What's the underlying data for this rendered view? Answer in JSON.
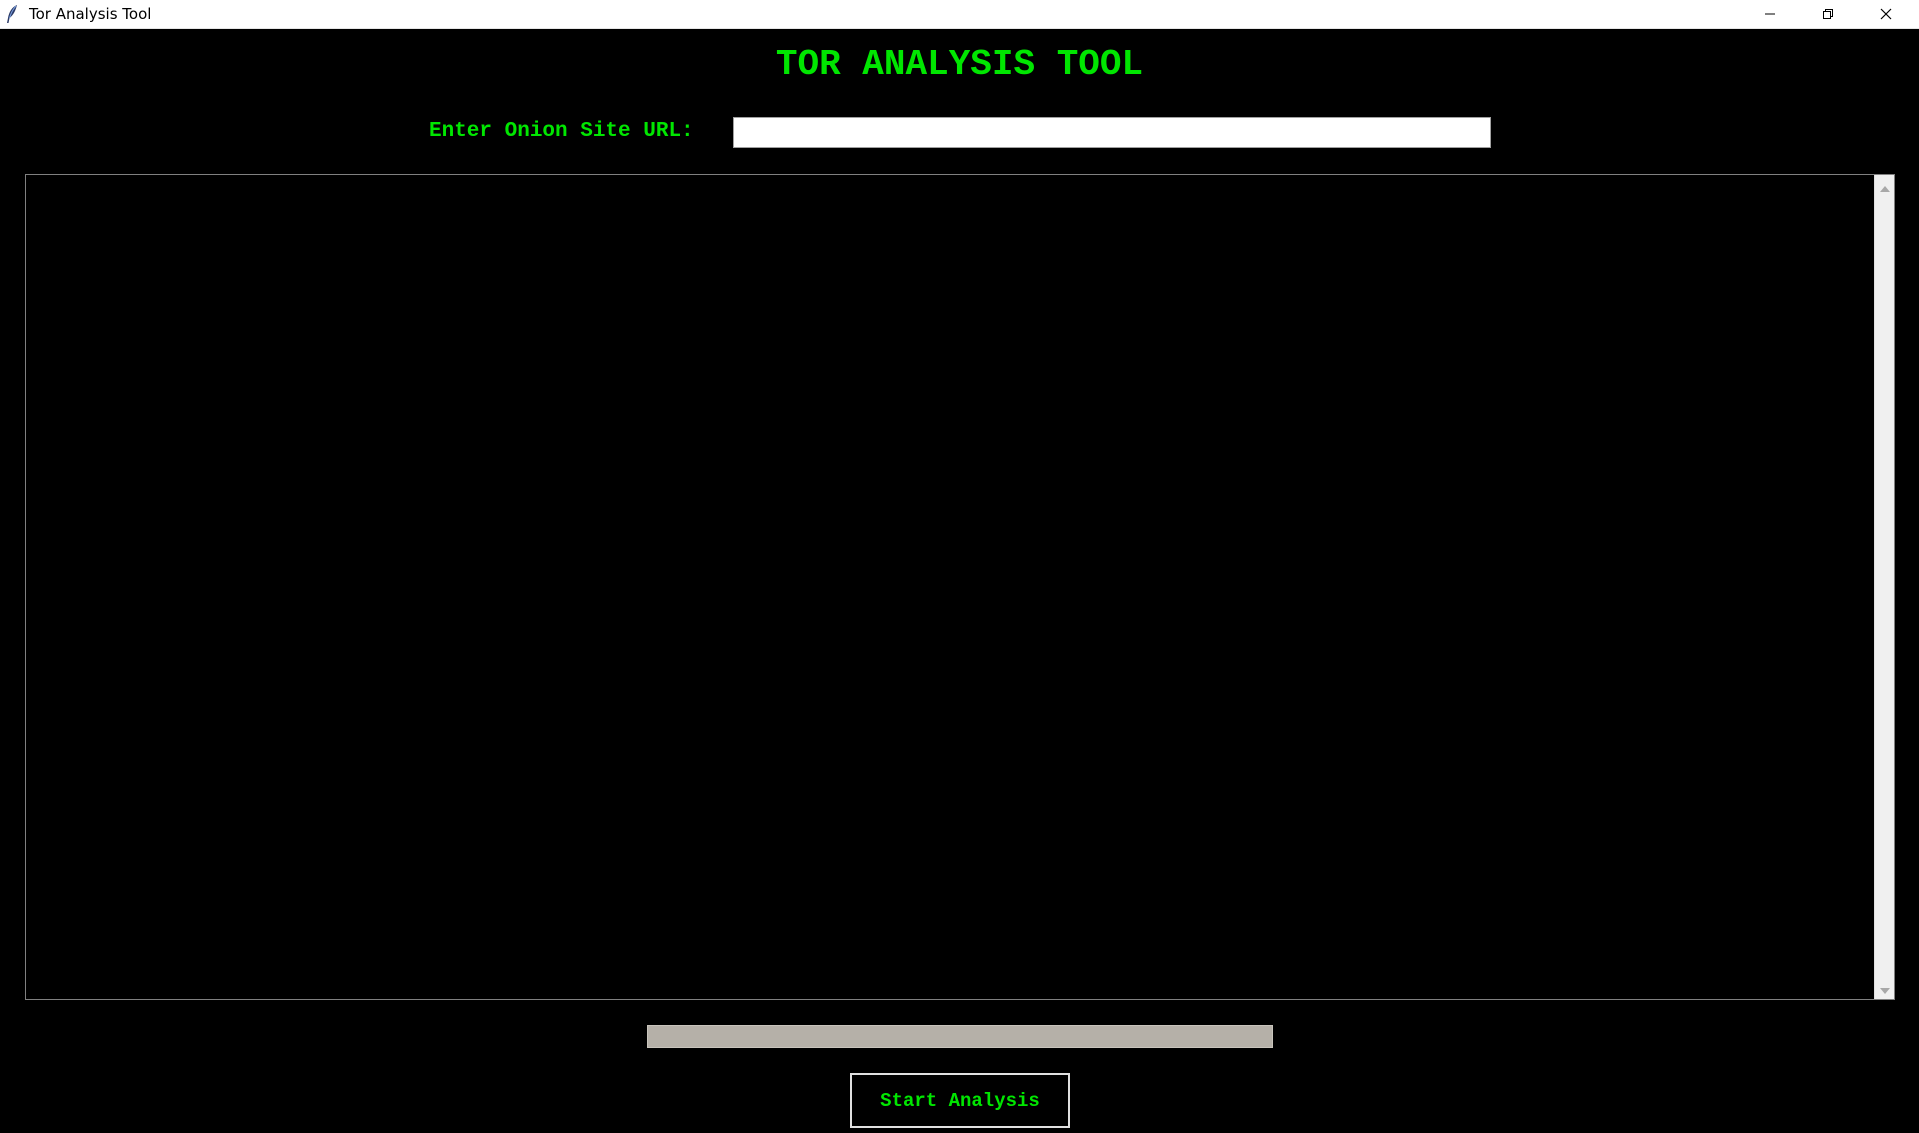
{
  "window": {
    "title": "Tor Analysis Tool",
    "icon": "feather-icon",
    "controls": [
      "minimize-icon",
      "restore-icon",
      "close-icon"
    ]
  },
  "header": {
    "title": "TOR ANALYSIS TOOL"
  },
  "url_form": {
    "label": "Enter Onion Site URL:",
    "value": "",
    "placeholder": ""
  },
  "output": {
    "text": ""
  },
  "progress": {
    "value_percent": 0
  },
  "actions": {
    "start_label": "Start Analysis"
  },
  "colors": {
    "background": "#000000",
    "accent_green": "#00e600",
    "progress_track": "#b5b0a8"
  }
}
